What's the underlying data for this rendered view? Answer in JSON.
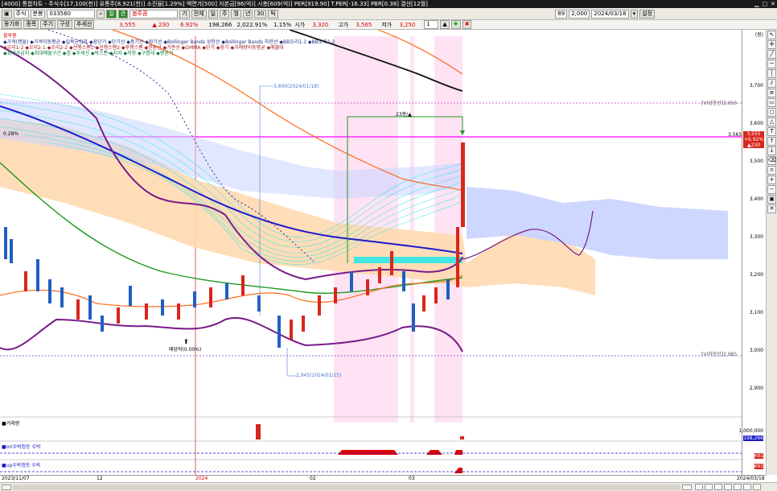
{
  "window": {
    "title": "[4000] 통합차트 - 주식수[17,100(천)] 유통주[8,921(천)] 소진율[1.29%] 액면가[500] 자본금[96(억)] 시총[609(억)] PER[919.90] T.PER[-16.33] PBR[0.38] 결산[12월]",
    "buttons": [
      "▁",
      "□",
      "✕"
    ]
  },
  "toolbar": {
    "market_select": "주식",
    "mode_select": "분봉",
    "code_input": "033560",
    "search_icon": "search-icon",
    "flags": [
      "일",
      "관"
    ],
    "stock_name": "블루콤",
    "period_buttons": [
      "기",
      "전체",
      "일",
      "주",
      "월",
      "년",
      "30",
      "틱"
    ],
    "count_input": "89",
    "ratio_input": "2,000",
    "date_input": "2024/03/18",
    "settings_label": "설정"
  },
  "quote_bar": {
    "tabs": [
      "동기화",
      "종목",
      "주기",
      "구성",
      "추세선"
    ],
    "price": "3,555",
    "change": "▲ 230",
    "change_pct": "6.92%",
    "volume": "198,266",
    "amount": "2,022.91%",
    "turnover": "1.15%",
    "open_label": "시가",
    "open": "3,320",
    "high_label": "고가",
    "high": "3,565",
    "low_label": "저가",
    "low": "3,250",
    "scroll_value": "1"
  },
  "chart": {
    "name_label": "블루콤",
    "legend_line1": "◆가격(캔들) ◆가격이동평균 ◆일목균형표 ◆장단기 ◆단기선 ◆중기선 ◆장기선 ◆Bollinger Bands 상한선 ◆Bollinger Bands 하한선 ◆BB오리1-1 ◆BB오리1-2",
    "legend_line2": "◆오리1-2 ◆오리2-1 ◆오리2-2 ◆선행스팬1 ◆선행스팬2 ◆후행스팬 ◆전환선 ◆기준선 ◆GMMA ◆단기 ◆장기 ◆거래량이동평균 ◆매물대",
    "legend_line3": "◆최대공급지 ◆최대매물구간 ◆갭 ◆추세선 ◆박스권 ◆지지 ◆저항 ◆구름대 ◆평균가",
    "annotations": {
      "high_point": "3,690(2024/01/18)",
      "low_point": "2,945(2024/01/25)",
      "dividend": "배당락(0.00%)",
      "pct_label": "0.28%",
      "gap_label": "23봉/▲",
      "upper_limit": "[VI상한선]3,655",
      "lower_limit": "[VI하한선]2,985",
      "current_line": "3,565"
    },
    "y_ticks": [
      "3,700",
      "3,600",
      "3,500",
      "3,400",
      "3,300",
      "3,200",
      "3,100",
      "3,000",
      "2,900"
    ],
    "y_unit": "(원)",
    "price_tag": [
      "3,555",
      "+6.92%",
      "▲230"
    ]
  },
  "volume_pane": {
    "title": "■거래량",
    "ticks": [
      "1,000,000",
      "198,266"
    ]
  },
  "indicator1": {
    "title": "■ori수박점등 수박",
    "tick": "491"
  },
  "indicator2": {
    "title": "■up수박점등 수박",
    "tick": "491"
  },
  "x_axis": {
    "start": "2023/11/07",
    "labels": [
      "12",
      "2024",
      "02",
      "03"
    ],
    "end": "2024/03/18"
  },
  "colors": {
    "up_candle": "#d8261c",
    "down_candle": "#1f5fc2",
    "cloud": "#ffd9b0",
    "cloud_blue": "#c9d3ff",
    "ma_blue": "#1a1acc",
    "ma_green": "#1f9a1f",
    "ma_purple": "#7a1a8a",
    "ma_orange": "#ff6a1a",
    "gmma": "#2ee6e6",
    "magenta": "#ff00ff"
  }
}
